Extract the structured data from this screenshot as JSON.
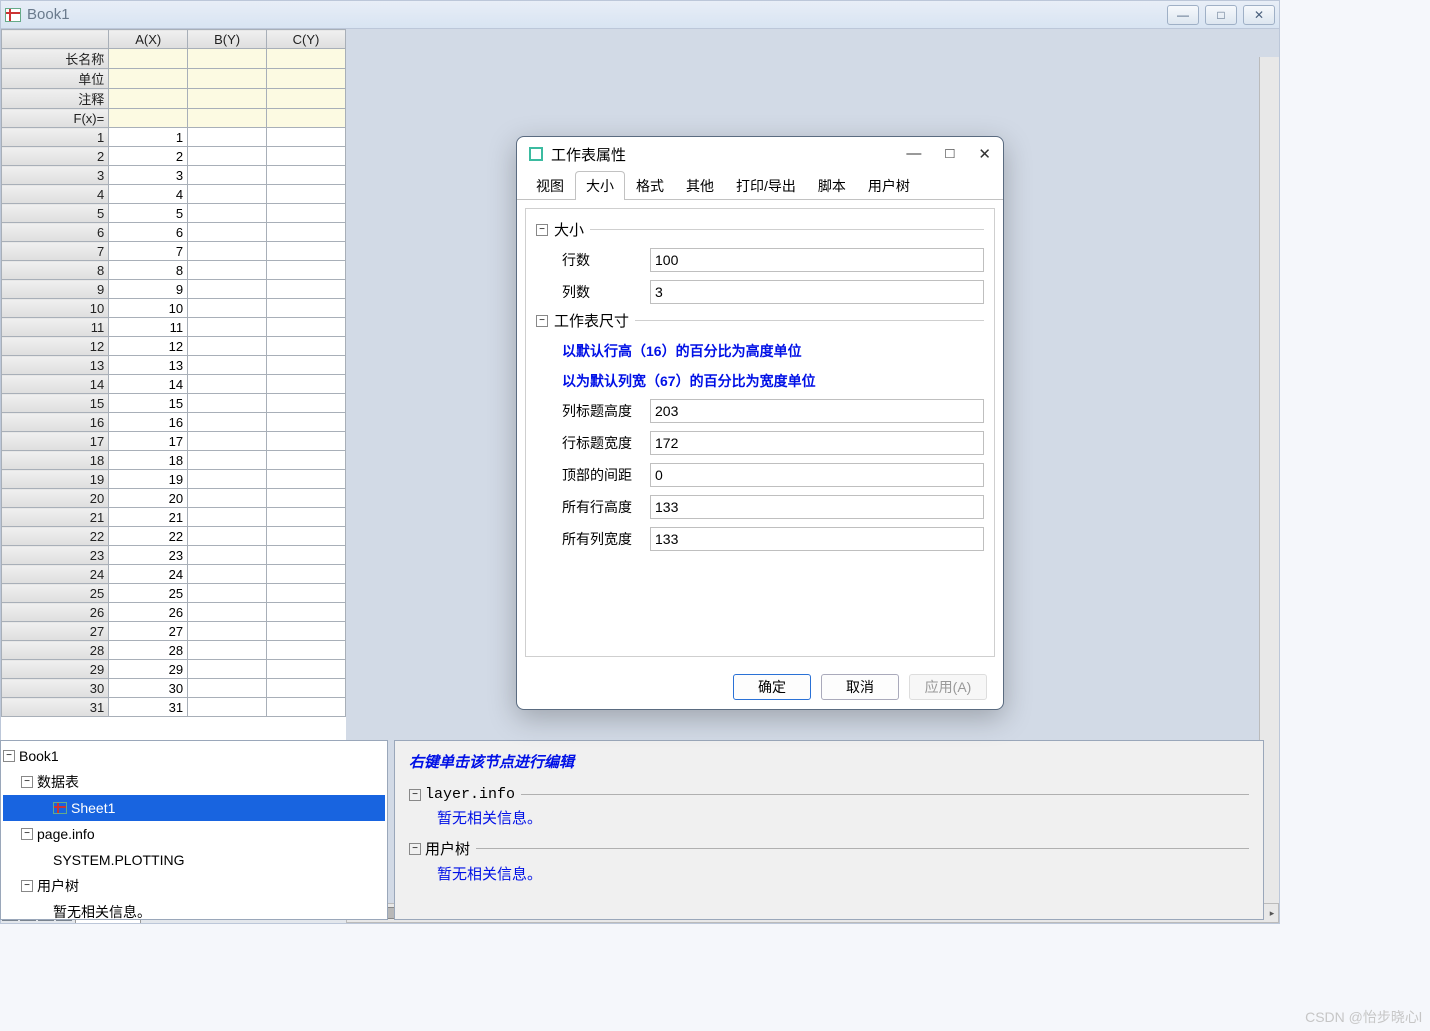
{
  "workbook": {
    "title": "Book1",
    "columns": [
      "A(X)",
      "B(Y)",
      "C(Y)"
    ],
    "headerRows": [
      "长名称",
      "单位",
      "注释",
      "F(x)="
    ],
    "rowCount": 31,
    "sheetTab": "Sheet1"
  },
  "dialog": {
    "title": "工作表属性",
    "tabs": [
      "视图",
      "大小",
      "格式",
      "其他",
      "打印/导出",
      "脚本",
      "用户树"
    ],
    "activeTab": 1,
    "group1": "大小",
    "rowsLabel": "行数",
    "rowsValue": "100",
    "colsLabel": "列数",
    "colsValue": "3",
    "group2": "工作表尺寸",
    "note1": "以默认行高（16）的百分比为高度单位",
    "note2": "以为默认列宽（67）的百分比为宽度单位",
    "f1l": "列标题高度",
    "f1v": "203",
    "f2l": "行标题宽度",
    "f2v": "172",
    "f3l": "顶部的间距",
    "f3v": "0",
    "f4l": "所有行高度",
    "f4v": "133",
    "f5l": "所有列宽度",
    "f5v": "133",
    "ok": "确定",
    "cancel": "取消",
    "apply": "应用(A)"
  },
  "tree": {
    "root": "Book1",
    "dataTable": "数据表",
    "sheet": "Sheet1",
    "pageInfo": "page.info",
    "plotting": "SYSTEM.PLOTTING",
    "userTree": "用户树",
    "noInfo": "暂无相关信息。"
  },
  "info": {
    "hint": "右键单击该节点进行编辑",
    "layer": "layer.info",
    "userTree": "用户树",
    "empty": "暂无相关信息。"
  },
  "watermark": "CSDN @怡步晓心l"
}
